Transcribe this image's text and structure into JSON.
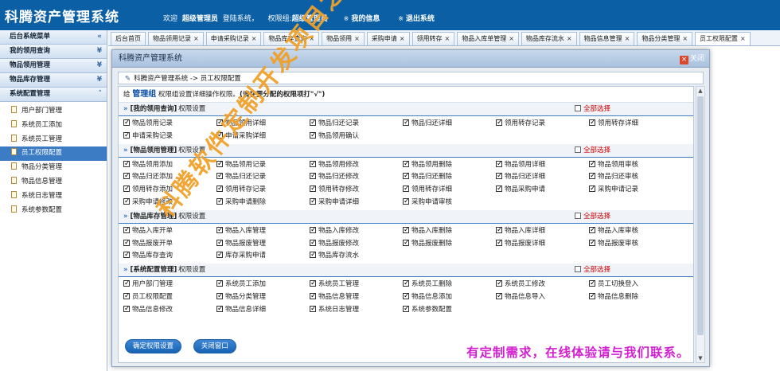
{
  "app": {
    "title": "科腾资产管理系统"
  },
  "topbar": {
    "welcome": "欢迎",
    "user": "超级管理员",
    "login_text": "登陆系统，",
    "perm_label": "权限组:",
    "perm_group": "超级管理员",
    "my_info": "我的信息",
    "logout": "退出系统",
    "link_icon": "※"
  },
  "sidebar": {
    "top_header": "后台系统菜单",
    "groups": [
      "我的领用查询",
      "物品领用管理",
      "物品库存管理",
      "系统配置管理"
    ],
    "items": [
      "用户部门管理",
      "系统员工添加",
      "系统员工管理",
      "员工权限配置",
      "物品分类管理",
      "物品信息管理",
      "系统日志管理",
      "系统参数配置"
    ],
    "active_item": "员工权限配置"
  },
  "tabs": [
    {
      "label": "后台首页",
      "closable": false
    },
    {
      "label": "物品领用记录",
      "closable": true
    },
    {
      "label": "申请采购记录",
      "closable": true
    },
    {
      "label": "物品库存查询",
      "closable": true
    },
    {
      "label": "物品领用",
      "closable": true
    },
    {
      "label": "采购申请",
      "closable": true
    },
    {
      "label": "领用转存",
      "closable": true
    },
    {
      "label": "物品入库单管理",
      "closable": true
    },
    {
      "label": "物品库存流水",
      "closable": true
    },
    {
      "label": "物品信息管理",
      "closable": true
    },
    {
      "label": "物品分类管理",
      "closable": true
    },
    {
      "label": "员工权限配置",
      "closable": true,
      "active": true
    }
  ],
  "dialog": {
    "title": "科腾资产管理系统",
    "close_label": "关闭",
    "breadcrumb": "科腾资产管理系统 -> 员工权限配置",
    "intro_prefix": "给",
    "role": "管理组",
    "intro_text": "权限组设置详细操作权限。",
    "intro_note": "(请在要分配的权限项打\"√\")",
    "select_all": "全部选择",
    "settings_suffix": "权限设置",
    "sections": [
      {
        "name": "[我的领用查询]",
        "items": [
          "物品领用记录",
          "物品领用详细",
          "物品归还记录",
          "物品归还详细",
          "领用转存记录",
          "领用转存详细",
          "申请采购记录",
          "申请采购详细",
          "物品领用确认"
        ]
      },
      {
        "name": "[物品领用管理]",
        "items": [
          "物品领用添加",
          "物品领用记录",
          "物品领用修改",
          "物品领用删除",
          "物品领用详细",
          "物品领用审核",
          "物品归还添加",
          "物品归还记录",
          "物品归还修改",
          "物品归还删除",
          "物品归还详细",
          "物品归还审核",
          "领用转存添加",
          "领用转存记录",
          "领用转存修改",
          "领用转存详细",
          "物品采购申请",
          "采购申请记录",
          "采购申请修改",
          "采购申请删除",
          "采购申请详细",
          "采购申请审核"
        ]
      },
      {
        "name": "[物品库存管理]",
        "items": [
          "物品入库开单",
          "物品入库管理",
          "物品入库修改",
          "物品入库删除",
          "物品入库详细",
          "物品入库审核",
          "物品报废开单",
          "物品报废管理",
          "物品报废修改",
          "物品报废删除",
          "物品报废详细",
          "物品报废审核",
          "物品库存查询",
          "库存采购申请",
          "物品库存流水"
        ]
      },
      {
        "name": "[系统配置管理]",
        "items": [
          "用户部门管理",
          "系统员工添加",
          "系统员工管理",
          "系统员工删除",
          "系统员工修改",
          "员工切换登入",
          "员工权限配置",
          "物品分类管理",
          "物品信息管理",
          "物品信息添加",
          "物品信息导入",
          "物品信息删除",
          "物品信息修改",
          "物品信息详细",
          "系统日志管理",
          "系统参数配置"
        ]
      }
    ],
    "buttons": {
      "confirm": "确定权限设置",
      "close": "关闭窗口"
    }
  },
  "watermark": "科腾软件定制开发项目之一",
  "promo": "有定制需求，在线体验请与我们联系。"
}
